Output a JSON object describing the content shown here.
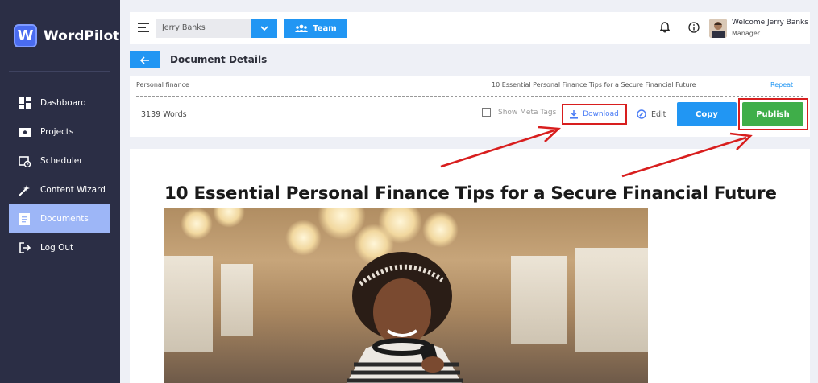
{
  "sidebar": {
    "logo_text": "WordPilot",
    "logo_letter": "W",
    "items": [
      {
        "label": "Dashboard",
        "icon": "dashboard-icon",
        "active": false
      },
      {
        "label": "Projects",
        "icon": "projects-icon",
        "active": false
      },
      {
        "label": "Scheduler",
        "icon": "scheduler-icon",
        "active": false
      },
      {
        "label": "Content Wizard",
        "icon": "content-wizard-icon",
        "active": false
      },
      {
        "label": "Documents",
        "icon": "documents-icon",
        "active": true
      },
      {
        "label": "Log Out",
        "icon": "logout-icon",
        "active": false
      }
    ]
  },
  "topbar": {
    "selected_user": "Jerry Banks",
    "team_label": "Team",
    "welcome": "Welcome Jerry Banks",
    "role": "Manager"
  },
  "page": {
    "title": "Document Details"
  },
  "details": {
    "category": "Personal finance",
    "headline": "10 Essential Personal Finance Tips for a Secure Financial Future",
    "repeat_label": "Repeat",
    "word_count": "3139 Words",
    "meta_tags_label": "Show Meta Tags",
    "download_label": "Download",
    "edit_label": "Edit",
    "copy_label": "Copy",
    "publish_label": "Publish"
  },
  "article": {
    "title": "10 Essential Personal Finance Tips for a Secure Financial Future"
  },
  "colors": {
    "sidebar_bg": "#2b2e45",
    "accent_blue": "#2196f3",
    "publish_green": "#3fae49",
    "annotation_red": "#d81e1e",
    "active_nav": "#9db6f7"
  }
}
